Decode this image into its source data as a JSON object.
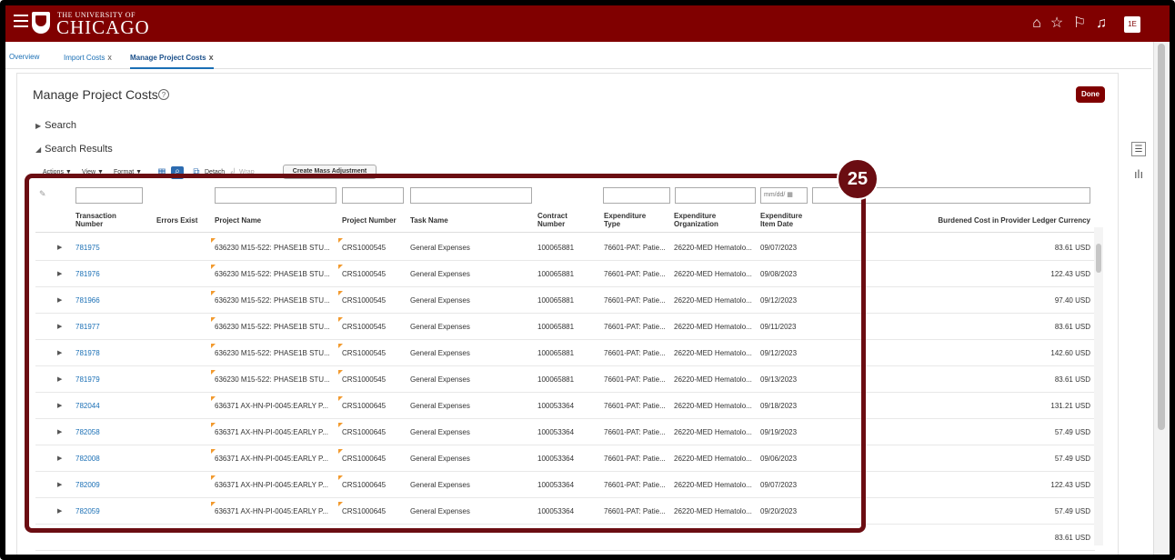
{
  "header": {
    "logo_small": "THE UNIVERSITY OF",
    "logo_big": "CHICAGO",
    "user_initials": "1E"
  },
  "tabs": [
    {
      "label": "Overview",
      "closable": false
    },
    {
      "label": "Import Costs",
      "closable": true
    },
    {
      "label": "Manage Project Costs",
      "closable": true,
      "active": true
    }
  ],
  "close_glyph": "x",
  "page": {
    "title": "Manage Project Costs",
    "help": "?",
    "done_label": "Done",
    "search_label": "Search",
    "results_label": "Search Results"
  },
  "toolbar": {
    "actions": "Actions ▼",
    "view": "View ▼",
    "format": "Format ▼",
    "detach": "Detach",
    "wrap": "Wrap",
    "mass_adjust": "Create Mass Adjustment"
  },
  "filter": {
    "date_placeholder": "mm/dd/"
  },
  "columns": {
    "transaction_number": "Transaction Number",
    "errors_exist": "Errors Exist",
    "project_name": "Project Name",
    "project_number": "Project Number",
    "task_name": "Task Name",
    "contract_number": "Contract Number",
    "expenditure_type": "Expenditure Type",
    "expenditure_org": "Expenditure Organization",
    "expenditure_date": "Expenditure Item Date",
    "burdened_cost": "Burdened Cost in Provider Ledger Currency"
  },
  "rows": [
    {
      "txn": "781975",
      "project": "636230 M15-522: PHASE1B STU...",
      "projnum": "CRS1000545",
      "task": "General Expenses",
      "contract": "100065881",
      "exptype": "76601-PAT: Patie...",
      "org": "26220-MED Hematolo...",
      "date": "09/07/2023",
      "cost": "83.61 USD"
    },
    {
      "txn": "781976",
      "project": "636230 M15-522: PHASE1B STU...",
      "projnum": "CRS1000545",
      "task": "General Expenses",
      "contract": "100065881",
      "exptype": "76601-PAT: Patie...",
      "org": "26220-MED Hematolo...",
      "date": "09/08/2023",
      "cost": "122.43 USD"
    },
    {
      "txn": "781966",
      "project": "636230 M15-522: PHASE1B STU...",
      "projnum": "CRS1000545",
      "task": "General Expenses",
      "contract": "100065881",
      "exptype": "76601-PAT: Patie...",
      "org": "26220-MED Hematolo...",
      "date": "09/12/2023",
      "cost": "97.40 USD"
    },
    {
      "txn": "781977",
      "project": "636230 M15-522: PHASE1B STU...",
      "projnum": "CRS1000545",
      "task": "General Expenses",
      "contract": "100065881",
      "exptype": "76601-PAT: Patie...",
      "org": "26220-MED Hematolo...",
      "date": "09/11/2023",
      "cost": "83.61 USD"
    },
    {
      "txn": "781978",
      "project": "636230 M15-522: PHASE1B STU...",
      "projnum": "CRS1000545",
      "task": "General Expenses",
      "contract": "100065881",
      "exptype": "76601-PAT: Patie...",
      "org": "26220-MED Hematolo...",
      "date": "09/12/2023",
      "cost": "142.60 USD"
    },
    {
      "txn": "781979",
      "project": "636230 M15-522: PHASE1B STU...",
      "projnum": "CRS1000545",
      "task": "General Expenses",
      "contract": "100065881",
      "exptype": "76601-PAT: Patie...",
      "org": "26220-MED Hematolo...",
      "date": "09/13/2023",
      "cost": "83.61 USD"
    },
    {
      "txn": "782044",
      "project": "636371 AX-HN-PI-0045:EARLY P...",
      "projnum": "CRS1000645",
      "task": "General Expenses",
      "contract": "100053364",
      "exptype": "76601-PAT: Patie...",
      "org": "26220-MED Hematolo...",
      "date": "09/18/2023",
      "cost": "131.21 USD"
    },
    {
      "txn": "782058",
      "project": "636371 AX-HN-PI-0045:EARLY P...",
      "projnum": "CRS1000645",
      "task": "General Expenses",
      "contract": "100053364",
      "exptype": "76601-PAT: Patie...",
      "org": "26220-MED Hematolo...",
      "date": "09/19/2023",
      "cost": "57.49 USD"
    },
    {
      "txn": "782008",
      "project": "636371 AX-HN-PI-0045:EARLY P...",
      "projnum": "CRS1000645",
      "task": "General Expenses",
      "contract": "100053364",
      "exptype": "76601-PAT: Patie...",
      "org": "26220-MED Hematolo...",
      "date": "09/06/2023",
      "cost": "57.49 USD"
    },
    {
      "txn": "782009",
      "project": "636371 AX-HN-PI-0045:EARLY P...",
      "projnum": "CRS1000645",
      "task": "General Expenses",
      "contract": "100053364",
      "exptype": "76601-PAT: Patie...",
      "org": "26220-MED Hematolo...",
      "date": "09/07/2023",
      "cost": "122.43 USD"
    },
    {
      "txn": "782059",
      "project": "636371 AX-HN-PI-0045:EARLY P...",
      "projnum": "CRS1000645",
      "task": "General Expenses",
      "contract": "100053364",
      "exptype": "76601-PAT: Patie...",
      "org": "26220-MED Hematolo...",
      "date": "09/20/2023",
      "cost": "57.49 USD"
    }
  ],
  "partial_row_cost": "83.61 USD",
  "annotation": {
    "badge": "25",
    "color": "#6b0d12"
  },
  "colors": {
    "brand": "#800000",
    "link": "#1a6fb5"
  }
}
